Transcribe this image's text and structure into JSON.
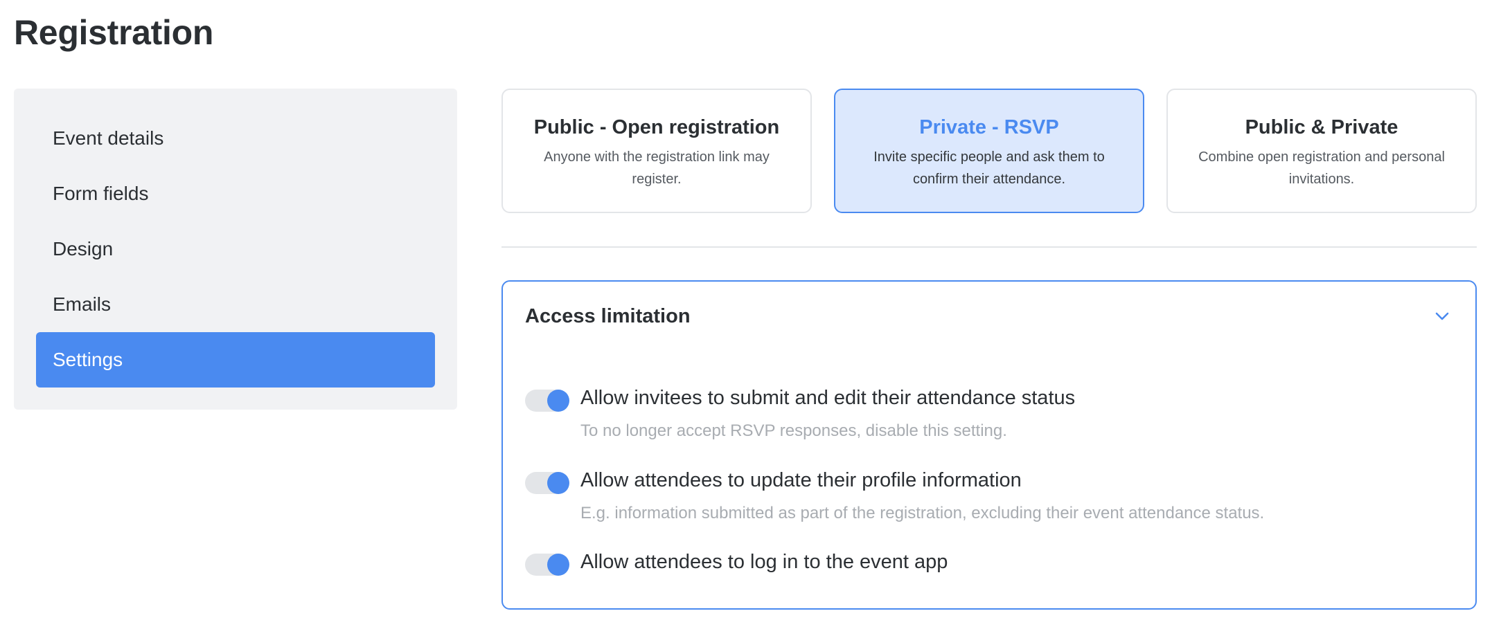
{
  "page": {
    "title": "Registration"
  },
  "sidebar": {
    "items": [
      {
        "label": "Event details",
        "active": false
      },
      {
        "label": "Form fields",
        "active": false
      },
      {
        "label": "Design",
        "active": false
      },
      {
        "label": "Emails",
        "active": false
      },
      {
        "label": "Settings",
        "active": true
      }
    ]
  },
  "registration_types": [
    {
      "title": "Public - Open registration",
      "description": "Anyone with the registration link may register.",
      "selected": false
    },
    {
      "title": "Private - RSVP",
      "description": "Invite specific people and ask them to confirm their attendance.",
      "selected": true
    },
    {
      "title": "Public & Private",
      "description": "Combine open registration and personal invitations.",
      "selected": false
    }
  ],
  "access_limitation": {
    "title": "Access limitation",
    "expanded": true,
    "chevron_icon": "chevron-down-icon",
    "settings": [
      {
        "label": "Allow invitees to submit and edit their attendance status",
        "help": "To no longer accept RSVP responses, disable this setting.",
        "enabled": true
      },
      {
        "label": "Allow attendees to update their profile information",
        "help": "E.g. information submitted as part of the registration, excluding their event attendance status.",
        "enabled": true
      },
      {
        "label": "Allow attendees to log in to the event app",
        "help": "",
        "enabled": true
      }
    ]
  },
  "colors": {
    "accent": "#4a8af0",
    "selected_card_bg": "#dce8fd",
    "sidebar_bg": "#f1f2f4",
    "toggle_track": "#e3e5e8",
    "text_primary": "#2b2f33",
    "text_muted": "#a8acb1"
  }
}
